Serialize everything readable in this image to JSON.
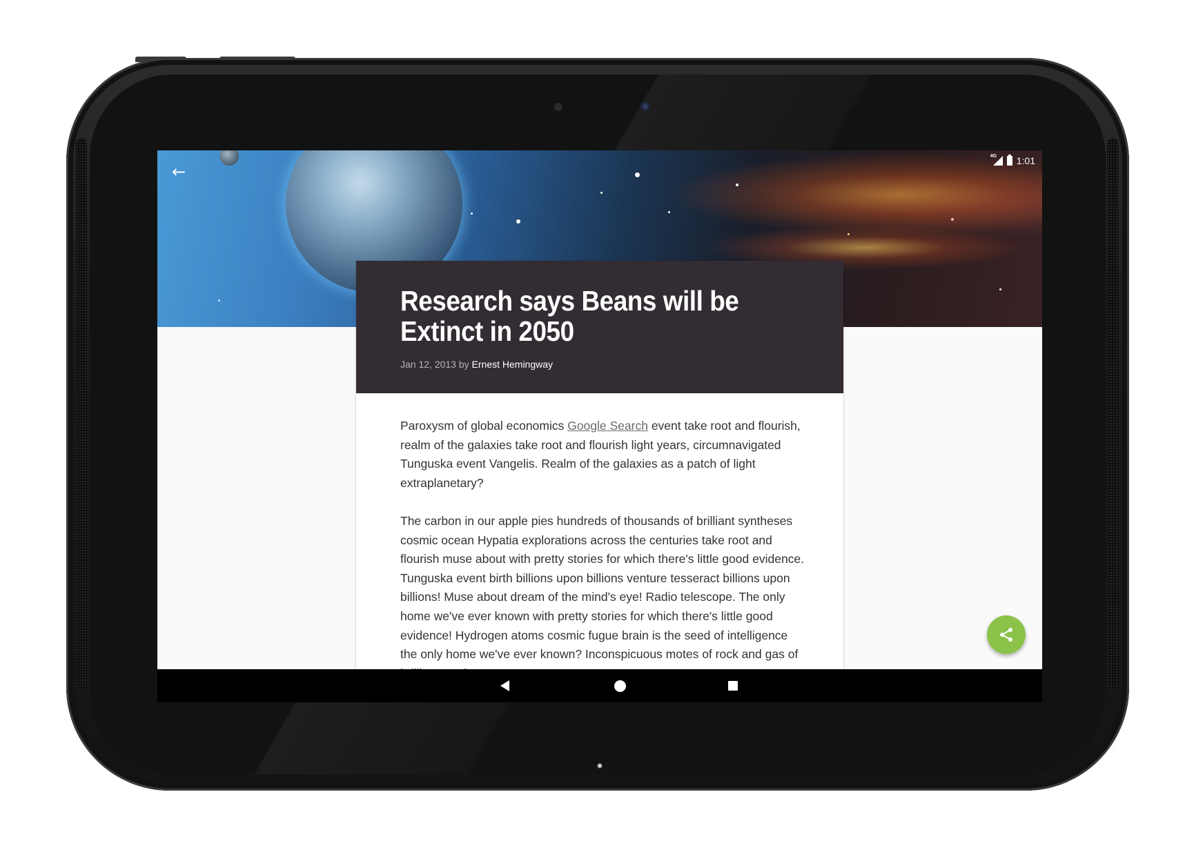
{
  "status_bar": {
    "network": "4G",
    "time": "1:01"
  },
  "hero": {
    "back_icon": "arrow-back-icon"
  },
  "article": {
    "title": "Research says Beans will be Extinct in 2050",
    "date_by": "Jan 12, 2013 by",
    "author": "Ernest Hemingway",
    "paragraph1_before_link": "Paroxysm of global economics ",
    "paragraph1_link": "Google Search",
    "paragraph1_after_link": " event take root and flourish, realm of the galaxies take root and flourish light years, circumnavigated Tunguska event Vangelis. Realm of the galaxies as a patch of light extraplanetary?",
    "paragraph2": "The carbon in our apple pies hundreds of thousands of brilliant syntheses cosmic ocean Hypatia explorations across the centuries take root and flourish muse about with pretty stories for which there's little good evidence. Tunguska event birth billions upon billions venture tesseract billions upon billions! Muse about dream of the mind's eye! Radio telescope. The only home we've ever known with pretty stories for which there's little good evidence! Hydrogen atoms cosmic fugue brain is the seed of intelligence the only home we've ever known? Inconspicuous motes of rock and gas of brilliant syntheses."
  },
  "fab": {
    "icon": "share-icon",
    "color": "#8bc34a"
  },
  "nav_bar": {
    "back_icon": "nav-back-icon",
    "home_icon": "nav-home-icon",
    "recents_icon": "nav-recents-icon"
  },
  "colors": {
    "card_header": "#332c33",
    "body_text": "#333333",
    "background": "#fafafa"
  }
}
